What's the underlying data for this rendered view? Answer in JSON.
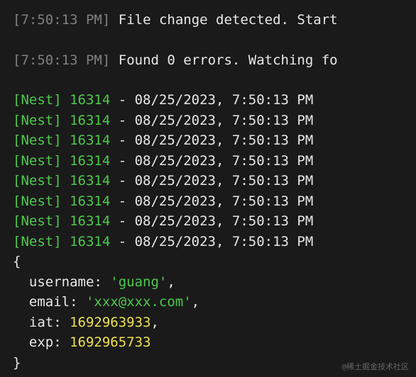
{
  "watcher": {
    "time1": "7:50:13 PM",
    "msg1": "File change detected. Start",
    "time2": "7:50:13 PM",
    "msg2": "Found 0 errors. Watching fo"
  },
  "nestLogs": [
    {
      "tag": "[Nest]",
      "pid": "16314",
      "sep": "-",
      "ts": "08/25/2023, 7:50:13 PM"
    },
    {
      "tag": "[Nest]",
      "pid": "16314",
      "sep": "-",
      "ts": "08/25/2023, 7:50:13 PM"
    },
    {
      "tag": "[Nest]",
      "pid": "16314",
      "sep": "-",
      "ts": "08/25/2023, 7:50:13 PM"
    },
    {
      "tag": "[Nest]",
      "pid": "16314",
      "sep": "-",
      "ts": "08/25/2023, 7:50:13 PM"
    },
    {
      "tag": "[Nest]",
      "pid": "16314",
      "sep": "-",
      "ts": "08/25/2023, 7:50:13 PM"
    },
    {
      "tag": "[Nest]",
      "pid": "16314",
      "sep": "-",
      "ts": "08/25/2023, 7:50:13 PM"
    },
    {
      "tag": "[Nest]",
      "pid": "16314",
      "sep": "-",
      "ts": "08/25/2023, 7:50:13 PM"
    },
    {
      "tag": "[Nest]",
      "pid": "16314",
      "sep": "-",
      "ts": "08/25/2023, 7:50:13 PM"
    }
  ],
  "object": {
    "openBrace": "{",
    "closeBrace": "}",
    "usernameKey": "username: ",
    "usernameVal": "'guang'",
    "emailKey": "email: ",
    "emailVal": "'xxx@xxx.com'",
    "iatKey": "iat: ",
    "iatVal": "1692963933",
    "expKey": "exp: ",
    "expVal": "1692965733",
    "comma": ","
  },
  "watermark": "@稀土掘金技术社区"
}
